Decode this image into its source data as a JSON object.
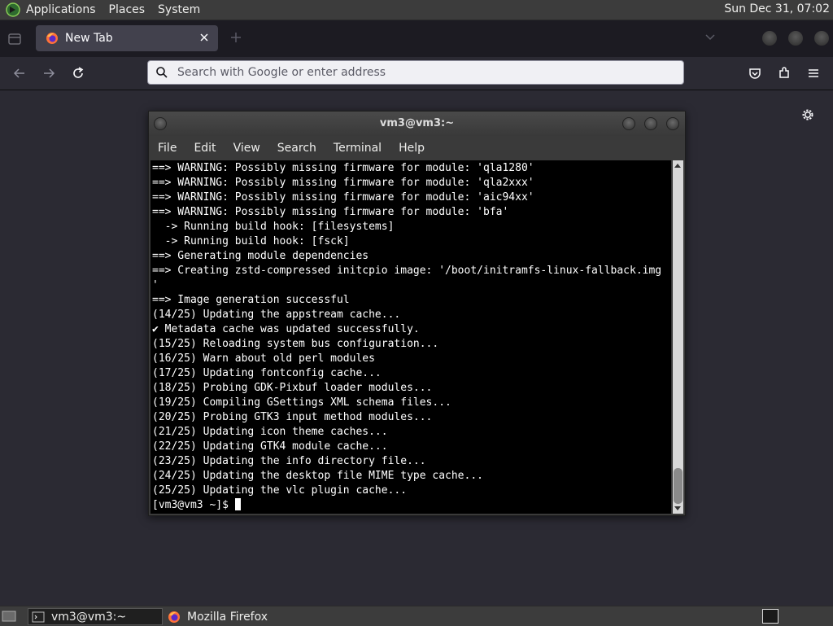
{
  "top_panel": {
    "menu": [
      "Applications",
      "Places",
      "System"
    ],
    "clock": "Sun Dec 31, 07:02"
  },
  "browser": {
    "tab": {
      "title": "New Tab"
    },
    "url_placeholder": "Search with Google or enter address"
  },
  "terminal": {
    "title": "vm3@vm3:~",
    "menu": [
      "File",
      "Edit",
      "View",
      "Search",
      "Terminal",
      "Help"
    ],
    "lines": [
      "==> WARNING: Possibly missing firmware for module: 'qla1280'",
      "==> WARNING: Possibly missing firmware for module: 'qla2xxx'",
      "==> WARNING: Possibly missing firmware for module: 'aic94xx'",
      "==> WARNING: Possibly missing firmware for module: 'bfa'",
      "  -> Running build hook: [filesystems]",
      "  -> Running build hook: [fsck]",
      "==> Generating module dependencies",
      "==> Creating zstd-compressed initcpio image: '/boot/initramfs-linux-fallback.img",
      "'",
      "==> Image generation successful",
      "(14/25) Updating the appstream cache...",
      "✔ Metadata cache was updated successfully.",
      "(15/25) Reloading system bus configuration...",
      "(16/25) Warn about old perl modules",
      "(17/25) Updating fontconfig cache...",
      "(18/25) Probing GDK-Pixbuf loader modules...",
      "(19/25) Compiling GSettings XML schema files...",
      "(20/25) Probing GTK3 input method modules...",
      "(21/25) Updating icon theme caches...",
      "(22/25) Updating GTK4 module cache...",
      "(23/25) Updating the info directory file...",
      "(24/25) Updating the desktop file MIME type cache...",
      "(25/25) Updating the vlc plugin cache..."
    ],
    "prompt": "[vm3@vm3 ~]$ "
  },
  "taskbar": {
    "items": [
      {
        "label": "vm3@vm3:~",
        "icon": "terminal-icon",
        "active": true
      },
      {
        "label": "Mozilla Firefox",
        "icon": "firefox-icon",
        "active": false
      }
    ]
  },
  "colors": {
    "panel": "#3c3c3c",
    "browser_chrome": "#1c1b22",
    "browser_toolbar": "#2b2a33",
    "terminal_bg": "#000000",
    "terminal_fg": "#ffffff"
  }
}
